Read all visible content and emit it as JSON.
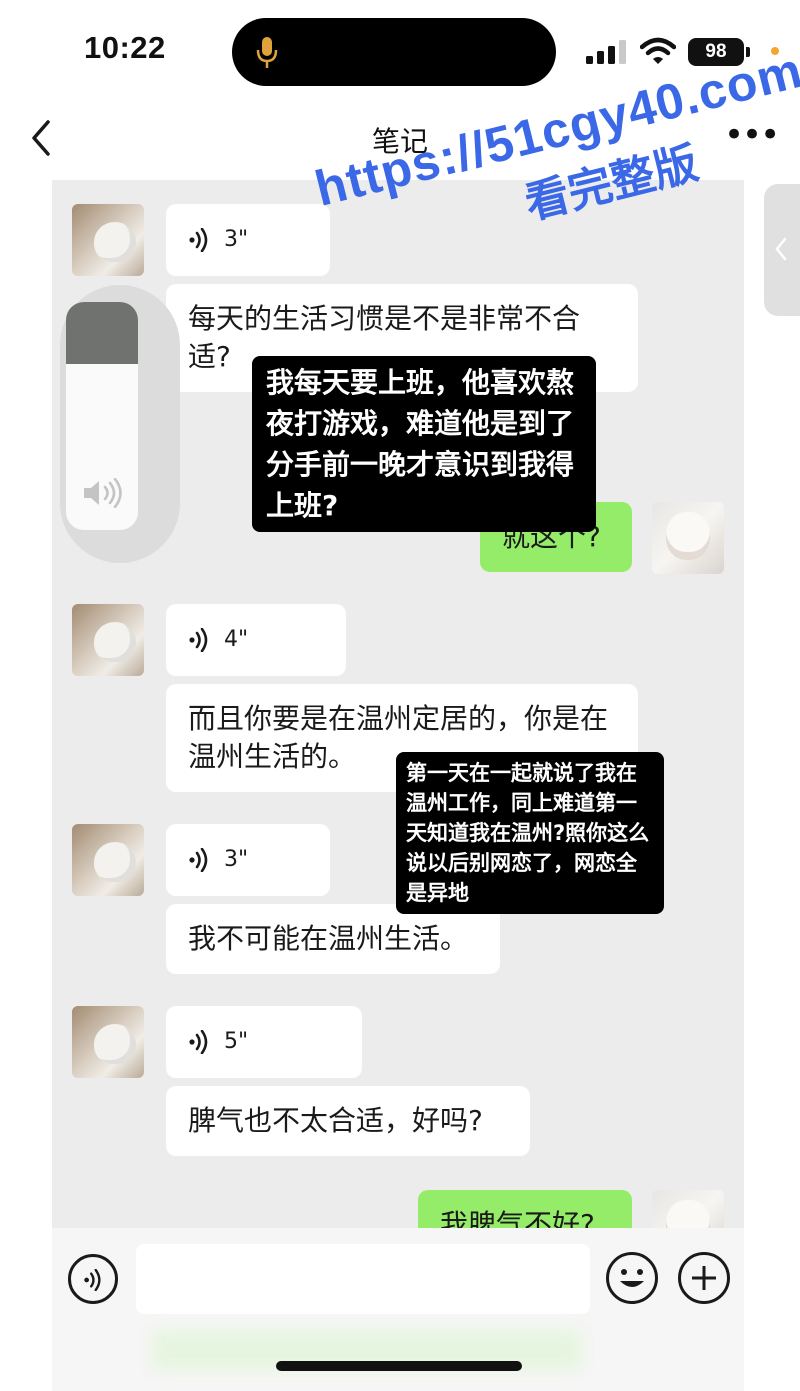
{
  "status_bar": {
    "time": "10:22",
    "battery": "98"
  },
  "nav": {
    "title": "笔记"
  },
  "messages": [
    {
      "voice_duration": "3\"",
      "text": "每天的生活习惯是不是非常不合适?"
    },
    {
      "sent_text": "就这个?"
    },
    {
      "voice_duration": "4\"",
      "text": "而且你要是在温州定居的，你是在温州生活的。"
    },
    {
      "voice_duration": "3\"",
      "text": "我不可能在温州生活。"
    },
    {
      "voice_duration": "5\"",
      "text": "脾气也不太合适，好吗?"
    },
    {
      "sent_text": "我脾气不好?"
    }
  ],
  "annotations": [
    "我每天要上班，他喜欢熬夜打游戏，难道他是到了分手前一晚才意识到我得上班?",
    "第一天在一起就说了我在温州工作，同上难道第一天知道我在温州?照你这么说以后别网恋了，网恋全是异地"
  ],
  "watermark": {
    "url": "https://51cgy40.com",
    "subtitle": "看完整版"
  },
  "volume": {
    "level": 0.27
  },
  "input": {
    "value": ""
  },
  "colors": {
    "sent_bubble": "#95ec69",
    "watermark": "#3a68e6",
    "annotation_bg": "#000000"
  },
  "icons": [
    "mic-icon",
    "signal-icon",
    "wifi-icon",
    "back-icon",
    "more-icon",
    "voice-icon",
    "speaker-icon",
    "chevron-left-icon",
    "emoji-icon",
    "plus-icon"
  ]
}
